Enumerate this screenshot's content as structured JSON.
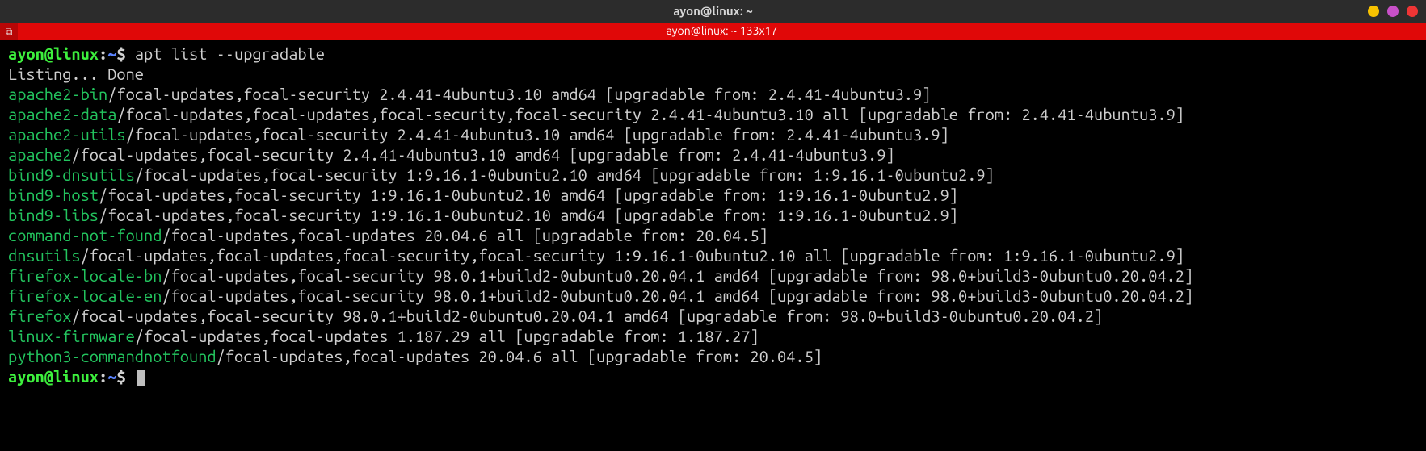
{
  "titlebar": {
    "title": "ayon@linux: ~"
  },
  "tabbar": {
    "label": "ayon@linux: ~ 133x17"
  },
  "prompt": {
    "user": "ayon@linux",
    "colon": ":",
    "path": "~",
    "dollar": "$ "
  },
  "command": "apt list --upgradable",
  "listing_line": "Listing... Done",
  "rows": [
    {
      "pkg": "apache2-bin",
      "rest": "/focal-updates,focal-security 2.4.41-4ubuntu3.10 amd64 [upgradable from: 2.4.41-4ubuntu3.9]"
    },
    {
      "pkg": "apache2-data",
      "rest": "/focal-updates,focal-updates,focal-security,focal-security 2.4.41-4ubuntu3.10 all [upgradable from: 2.4.41-4ubuntu3.9]"
    },
    {
      "pkg": "apache2-utils",
      "rest": "/focal-updates,focal-security 2.4.41-4ubuntu3.10 amd64 [upgradable from: 2.4.41-4ubuntu3.9]"
    },
    {
      "pkg": "apache2",
      "rest": "/focal-updates,focal-security 2.4.41-4ubuntu3.10 amd64 [upgradable from: 2.4.41-4ubuntu3.9]"
    },
    {
      "pkg": "bind9-dnsutils",
      "rest": "/focal-updates,focal-security 1:9.16.1-0ubuntu2.10 amd64 [upgradable from: 1:9.16.1-0ubuntu2.9]"
    },
    {
      "pkg": "bind9-host",
      "rest": "/focal-updates,focal-security 1:9.16.1-0ubuntu2.10 amd64 [upgradable from: 1:9.16.1-0ubuntu2.9]"
    },
    {
      "pkg": "bind9-libs",
      "rest": "/focal-updates,focal-security 1:9.16.1-0ubuntu2.10 amd64 [upgradable from: 1:9.16.1-0ubuntu2.9]"
    },
    {
      "pkg": "command-not-found",
      "rest": "/focal-updates,focal-updates 20.04.6 all [upgradable from: 20.04.5]"
    },
    {
      "pkg": "dnsutils",
      "rest": "/focal-updates,focal-updates,focal-security,focal-security 1:9.16.1-0ubuntu2.10 all [upgradable from: 1:9.16.1-0ubuntu2.9]"
    },
    {
      "pkg": "firefox-locale-bn",
      "rest": "/focal-updates,focal-security 98.0.1+build2-0ubuntu0.20.04.1 amd64 [upgradable from: 98.0+build3-0ubuntu0.20.04.2]"
    },
    {
      "pkg": "firefox-locale-en",
      "rest": "/focal-updates,focal-security 98.0.1+build2-0ubuntu0.20.04.1 amd64 [upgradable from: 98.0+build3-0ubuntu0.20.04.2]"
    },
    {
      "pkg": "firefox",
      "rest": "/focal-updates,focal-security 98.0.1+build2-0ubuntu0.20.04.1 amd64 [upgradable from: 98.0+build3-0ubuntu0.20.04.2]"
    },
    {
      "pkg": "linux-firmware",
      "rest": "/focal-updates,focal-updates 1.187.29 all [upgradable from: 1.187.27]"
    },
    {
      "pkg": "python3-commandnotfound",
      "rest": "/focal-updates,focal-updates 20.04.6 all [upgradable from: 20.04.5]"
    }
  ]
}
